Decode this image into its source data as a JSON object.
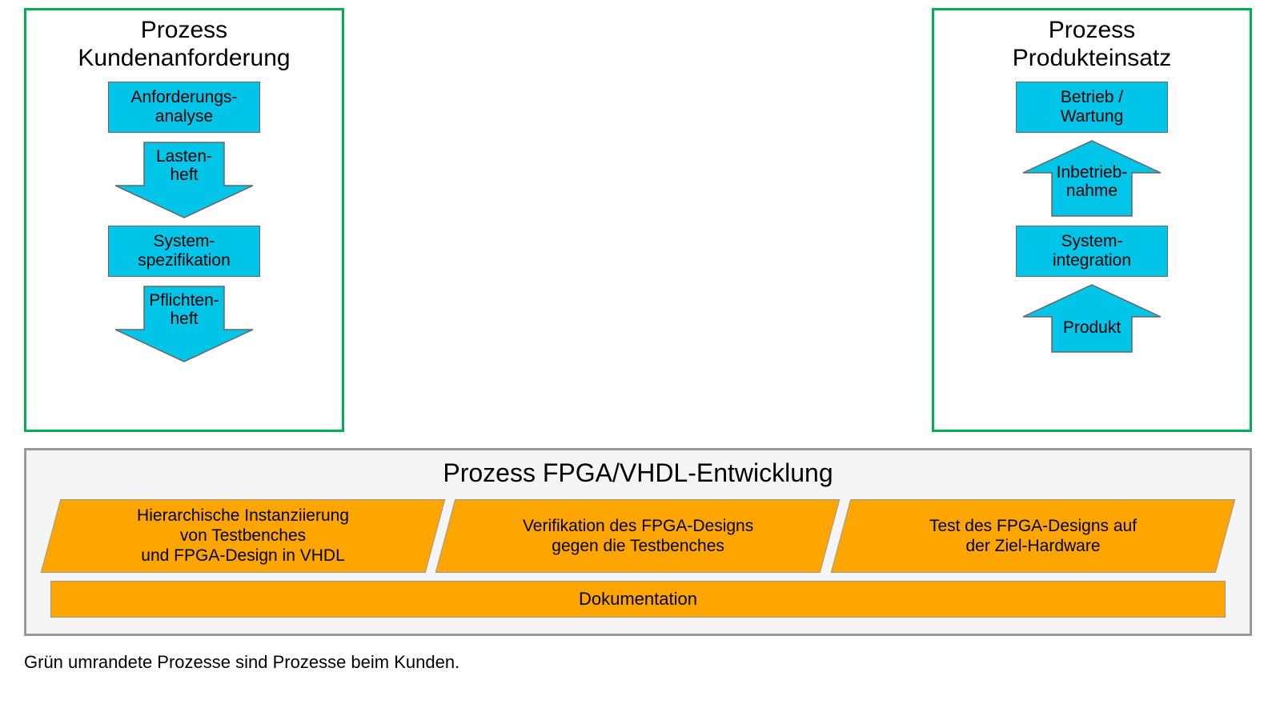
{
  "leftBox": {
    "title": "Prozess\nKundenanforderung",
    "step1": "Anforderungs-\nanalyse",
    "arrow1": "Lasten-\nheft",
    "step2": "System-\nspezifikation",
    "arrow2": "Pflichten-\nheft"
  },
  "rightBox": {
    "title": "Prozess\nProdukteinsatz",
    "step1": "Betrieb /\nWartung",
    "arrow1": "Inbetrieb-\nnahme",
    "step2": "System-\nintegration",
    "arrow2": "Produkt"
  },
  "devBox": {
    "title": "Prozess FPGA/VHDL-Entwicklung",
    "p1": "Hierarchische Instanziierung\nvon Testbenches\nund FPGA-Design  in VHDL",
    "p2": "Verifikation des FPGA-Designs\ngegen die Testbenches",
    "p3": "Test des FPGA-Designs auf\nder Ziel-Hardware",
    "doc": "Dokumentation"
  },
  "footnote": "Grün umrandete Prozesse sind Prozesse beim Kunden."
}
